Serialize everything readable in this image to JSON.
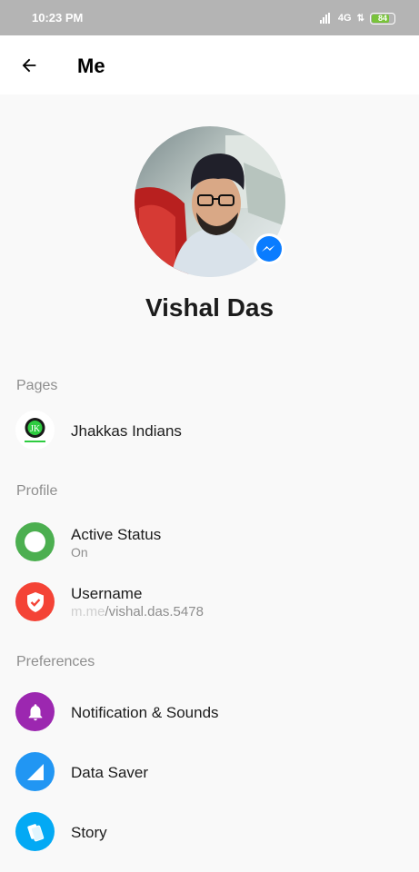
{
  "status_bar": {
    "time": "10:23 PM",
    "network": "4G",
    "battery": "84",
    "battery_level": 0.84
  },
  "header": {
    "title": "Me",
    "back_icon": "arrow-left-icon"
  },
  "profile": {
    "name": "Vishal Das",
    "badge_icon": "messenger-icon"
  },
  "sections": {
    "pages": {
      "title": "Pages",
      "items": [
        {
          "label": "Jhakkas Indians",
          "icon": "page-logo-icon"
        }
      ]
    },
    "profile": {
      "title": "Profile",
      "items": [
        {
          "label": "Active Status",
          "subtitle": "On",
          "icon": "active-status-icon",
          "color": "#4caf50"
        },
        {
          "label": "Username",
          "subtitle_prefix": "m.me",
          "subtitle": "/vishal.das.5478",
          "icon": "shield-check-icon",
          "color": "#f44336"
        }
      ]
    },
    "preferences": {
      "title": "Preferences",
      "items": [
        {
          "label": "Notification & Sounds",
          "icon": "bell-icon",
          "color": "#9c27b0"
        },
        {
          "label": "Data Saver",
          "icon": "data-saver-icon",
          "color": "#2196f3"
        },
        {
          "label": "Story",
          "icon": "story-icon",
          "color": "#03a9f4"
        }
      ]
    }
  }
}
